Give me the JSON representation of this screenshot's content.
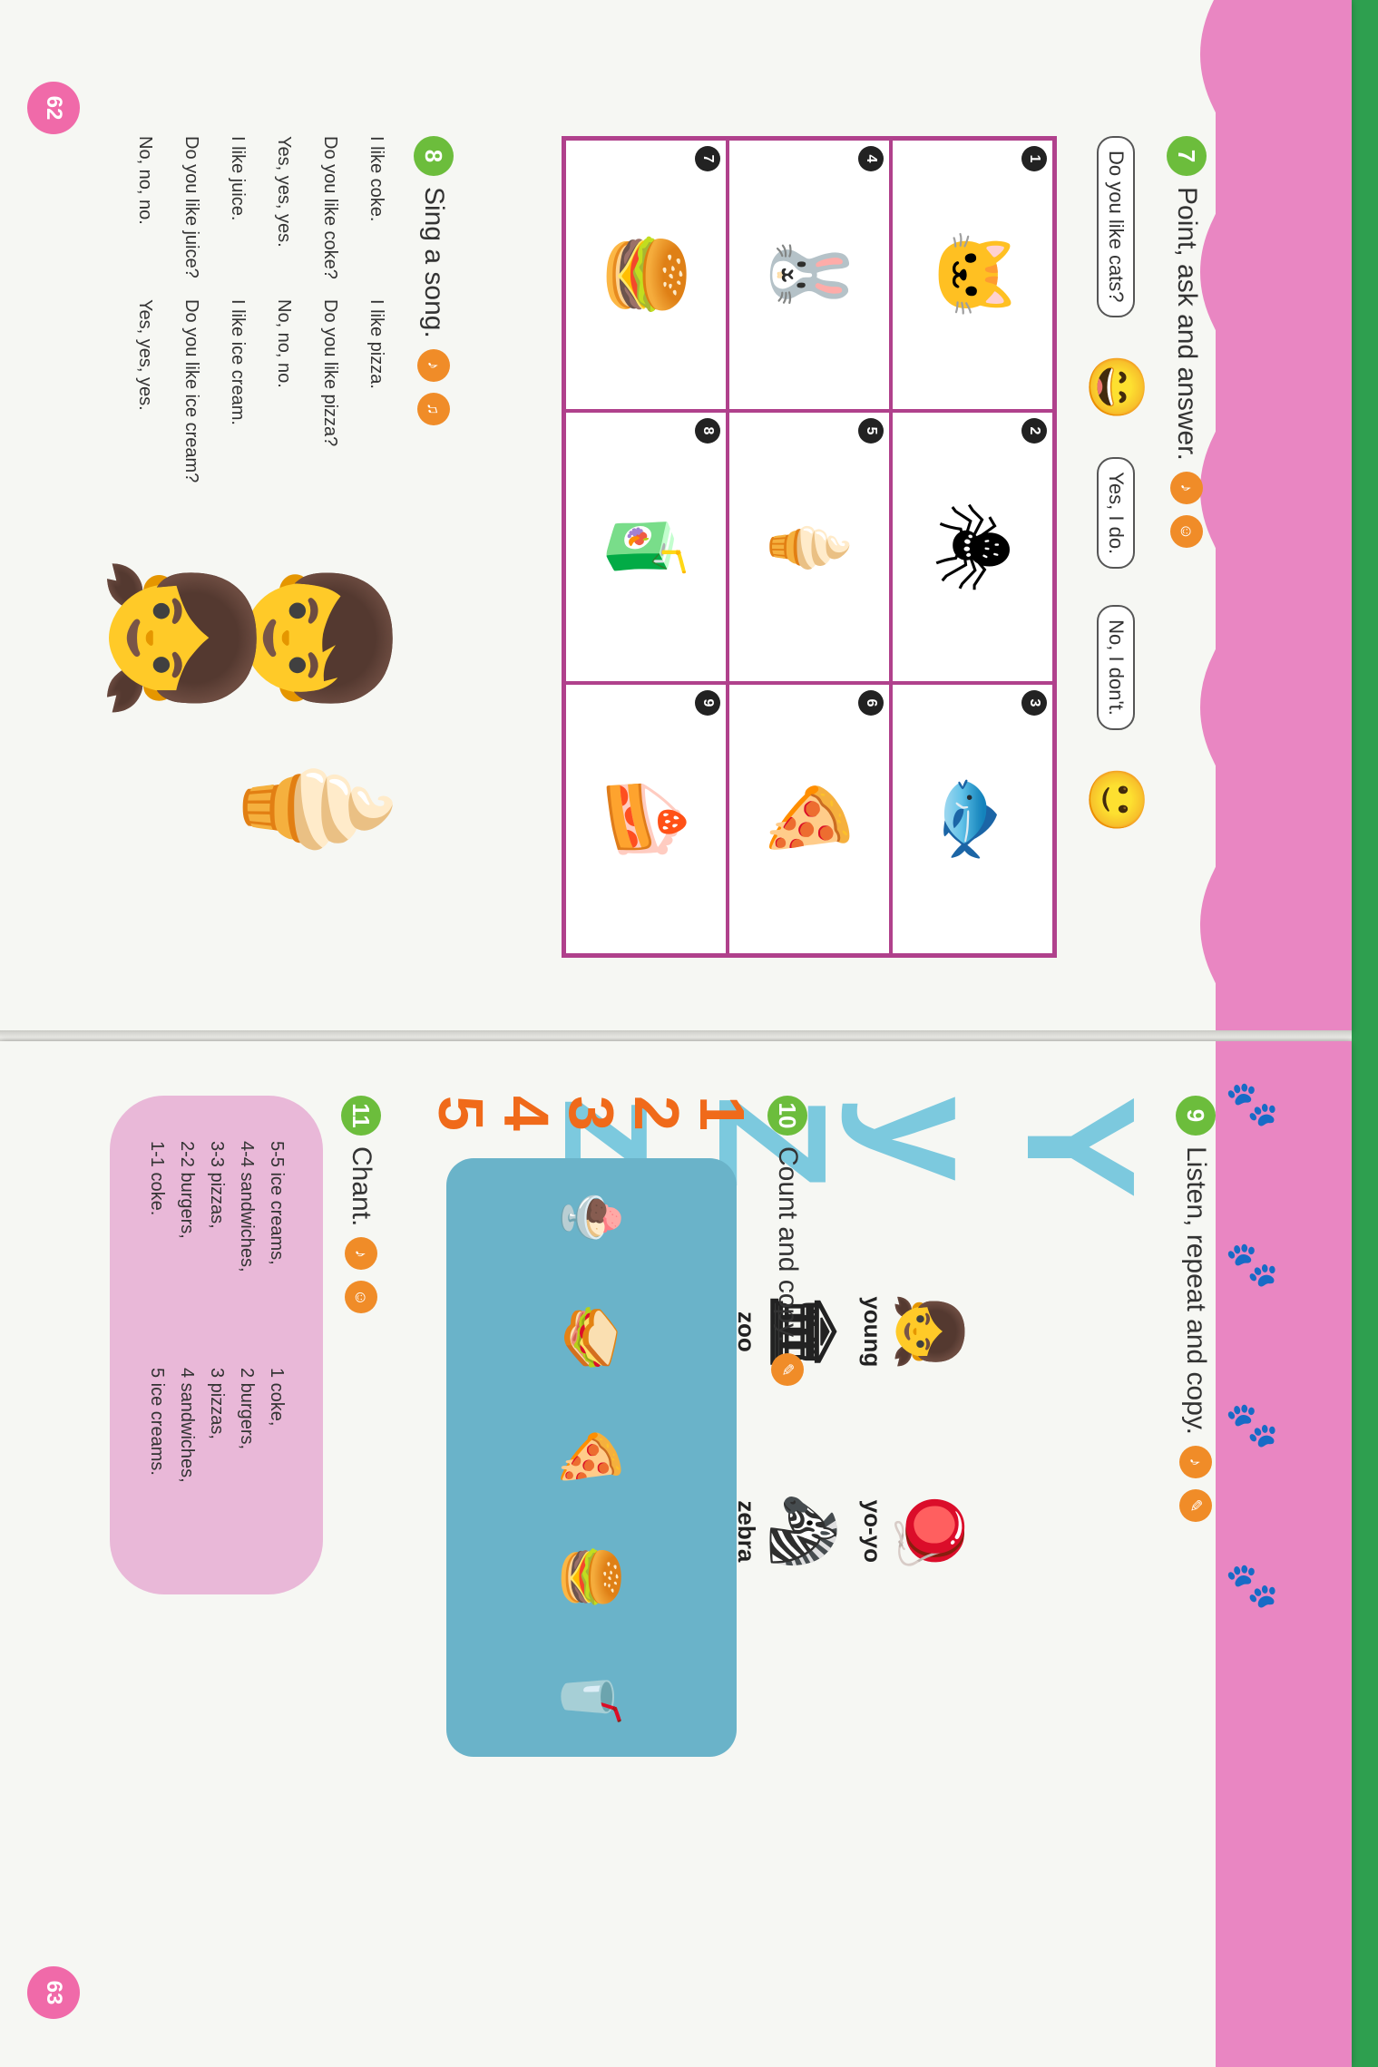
{
  "page62": {
    "page_number": "62",
    "ex7": {
      "number": "7",
      "title": "Point, ask and answer.",
      "bubbles": [
        "Do you like cats?",
        "Yes, I do.",
        "No, I don't."
      ],
      "cells": [
        {
          "n": "1",
          "pic": "🐱"
        },
        {
          "n": "2",
          "pic": "🕷"
        },
        {
          "n": "3",
          "pic": "🐟"
        },
        {
          "n": "4",
          "pic": "🐰"
        },
        {
          "n": "5",
          "pic": "🍦"
        },
        {
          "n": "6",
          "pic": "🍕"
        },
        {
          "n": "7",
          "pic": "🍔"
        },
        {
          "n": "8",
          "pic": "🧃"
        },
        {
          "n": "9",
          "pic": "🍰"
        }
      ]
    },
    "ex8": {
      "number": "8",
      "title": "Sing a song.",
      "lines_left": [
        "I like coke.",
        "Do you like coke?",
        "Yes, yes, yes.",
        "I like juice.",
        "Do you like juice?",
        "No, no, no."
      ],
      "lines_right": [
        "I like pizza.",
        "Do you like pizza?",
        "No, no, no.",
        "I like ice cream.",
        "Do you like ice cream?",
        "Yes, yes, yes."
      ]
    }
  },
  "page63": {
    "page_number": "63",
    "ex9": {
      "number": "9",
      "title": "Listen, repeat and copy.",
      "letters": [
        "Y y",
        "Z z"
      ],
      "words": [
        {
          "word": "young",
          "pic": "👧"
        },
        {
          "word": "yo-yo",
          "pic": "🪀"
        },
        {
          "word": "zoo",
          "pic": "🏛"
        },
        {
          "word": "zebra",
          "pic": "🦓"
        }
      ]
    },
    "ex10": {
      "number": "10",
      "title": "Count and copy.",
      "counts": [
        "1",
        "2",
        "3",
        "4",
        "5"
      ],
      "foods": [
        "🍨",
        "🥪",
        "🍕",
        "🍔",
        "🥤"
      ]
    },
    "ex11": {
      "number": "11",
      "title": "Chant.",
      "lines_left": [
        "5-5 ice creams,",
        "4-4 sandwiches,",
        "3-3 pizzas,",
        "2-2 burgers,",
        "1-1 coke."
      ],
      "lines_right": [
        "1 coke,",
        "2 burgers,",
        "3 pizzas,",
        "4 sandwiches,",
        "5 ice creams."
      ]
    }
  },
  "colors": {
    "accent_green": "#6cbd3c",
    "audio_orange": "#f08c28",
    "border_magenta": "#b0418c",
    "band_pink": "#e986c2",
    "number_orange": "#f06a1a"
  }
}
